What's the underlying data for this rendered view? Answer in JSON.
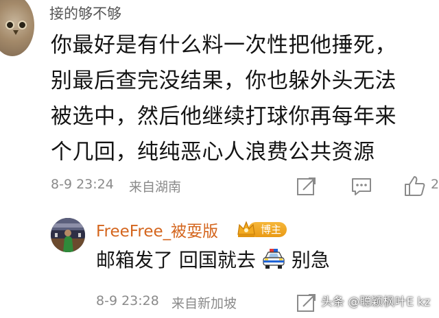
{
  "comment1": {
    "username": "接的够不够",
    "lines": [
      "你最好是有什么料一次性把他捶死，",
      "别最后查完没结果，你也躲外头无法",
      "被选中，然后他继续打球你再每年来",
      "个几回，纯纯恶心人浪费公共资源"
    ],
    "timestamp": "8-9 23:24",
    "location": "来自湖南",
    "likes_partial": "2"
  },
  "comment2": {
    "username": "FreeFree_被耍版",
    "badge": "博主",
    "text_before_emoji": "邮箱发了 回国就去",
    "emoji": "police-car-emoji",
    "text_after_emoji": "别急",
    "timestamp": "8-9 23:28",
    "location": "来自新加坡"
  },
  "watermark": "头条 @聪颖枫叶E kz",
  "colors": {
    "username_orange": "#d4651d",
    "badge_gold": "#f0a52a",
    "meta_gray": "#8a8a8a"
  }
}
